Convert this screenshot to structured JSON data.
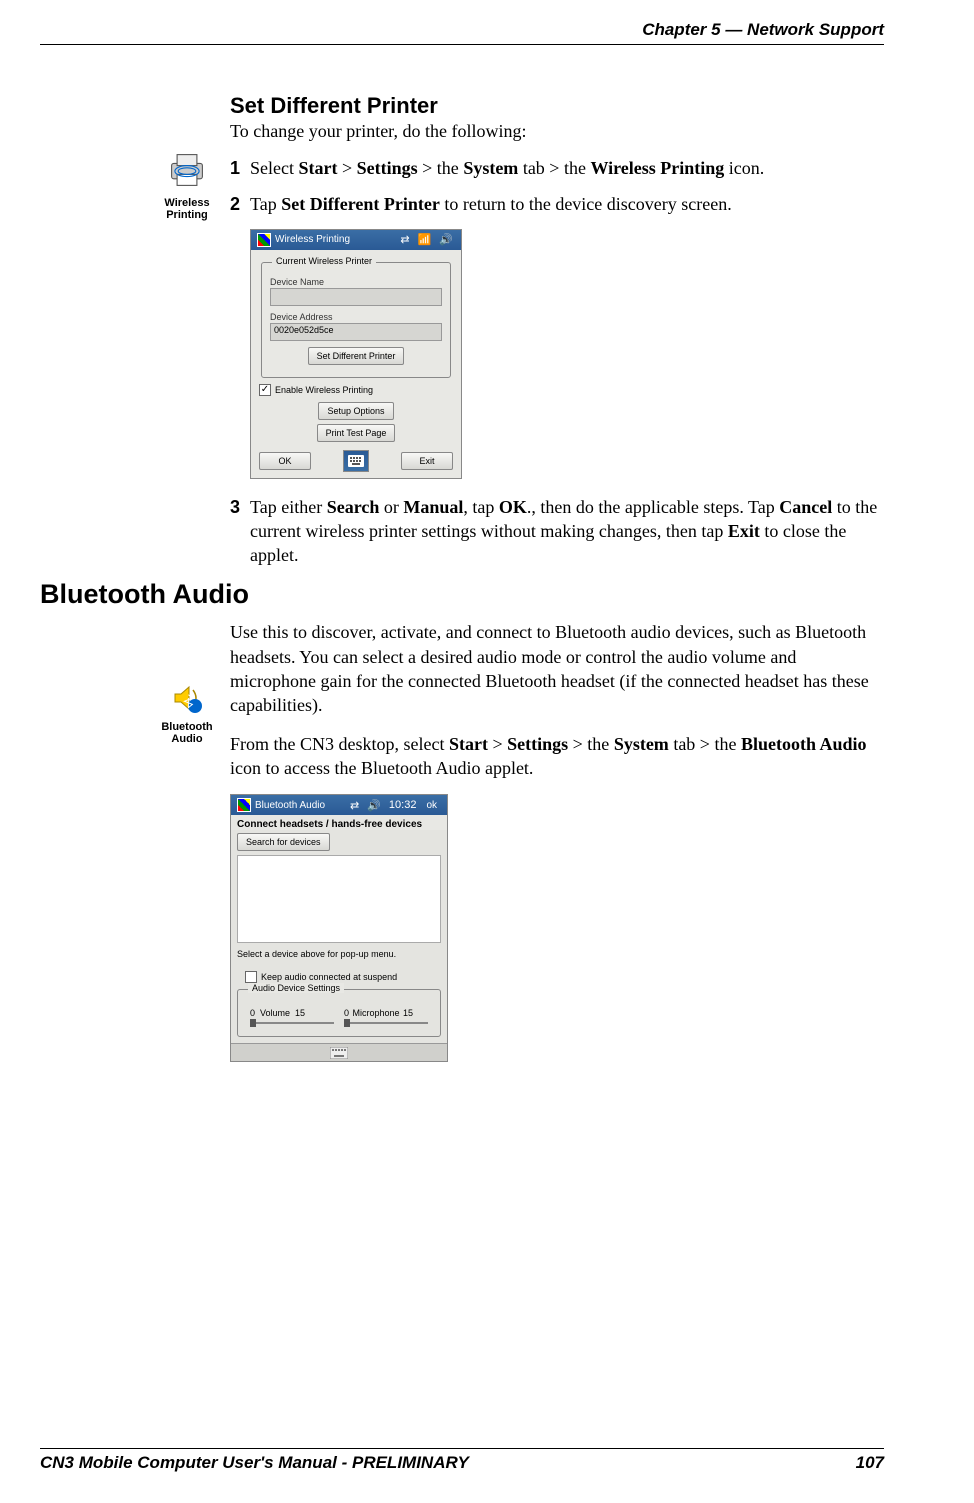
{
  "header": "Chapter 5 —  Network Support",
  "footer": {
    "left": "CN3 Mobile Computer User's Manual - PRELIMINARY",
    "right": "107"
  },
  "section1": {
    "title": "Set Different Printer",
    "intro": "To change your printer, do the following:",
    "icon_label": "Wireless Printing",
    "steps": {
      "s1num": "1",
      "s1a": "Select ",
      "s1b": "Start",
      "s1c": " > ",
      "s1d": "Settings",
      "s1e": " > the ",
      "s1f": "System",
      "s1g": " tab > the ",
      "s1h": "Wireless Printing",
      "s1i": " icon.",
      "s2num": "2",
      "s2a": "Tap ",
      "s2b": "Set Different Printer",
      "s2c": " to return to the device discovery screen.",
      "s3num": "3",
      "s3a": "Tap either ",
      "s3b": "Search",
      "s3c": " or ",
      "s3d": "Manual",
      "s3e": ", tap ",
      "s3f": "OK",
      "s3g": "., then do the applicable steps. Tap ",
      "s3h": "Cancel",
      "s3i": " to the current wireless printer settings without making changes, then tap ",
      "s3j": "Exit",
      "s3k": " to close the applet."
    }
  },
  "shot1": {
    "title": "Wireless Printing",
    "groupbox": "Current Wireless Printer",
    "dev_name_label": "Device Name",
    "dev_name_value": "",
    "dev_addr_label": "Device Address",
    "dev_addr_value": "0020e052d5ce",
    "btn_setdiff": "Set Different Printer",
    "chk_enable": "Enable Wireless Printing",
    "btn_setup": "Setup Options",
    "btn_test": "Print Test Page",
    "btn_ok": "OK",
    "btn_exit": "Exit"
  },
  "section2": {
    "heading": "Bluetooth Audio",
    "icon_label": "Bluetooth Audio",
    "para1": "Use this to discover, activate, and connect to Bluetooth audio devices, such as Bluetooth headsets. You can select a desired audio mode or control the audio volume and microphone gain for the connected Bluetooth headset (if the connected headset has these capabilities).",
    "p2a": "From the CN3 desktop, select ",
    "p2b": "Start",
    "p2c": " > ",
    "p2d": "Settings",
    "p2e": " > the ",
    "p2f": "System",
    "p2g": " tab > the ",
    "p2h": "Bluetooth Audio",
    "p2i": " icon to access the Bluetooth Audio applet."
  },
  "shot2": {
    "title": "Bluetooth Audio",
    "time": "10:32",
    "ok": "ok",
    "subhead": "Connect headsets / hands-free devices",
    "btn_search": "Search for devices",
    "hint": "Select a device above for pop-up menu.",
    "chk_keep": "Keep audio connected at suspend",
    "group": "Audio Device Settings",
    "vol_lo": "0",
    "vol_label": "Volume",
    "vol_hi": "15",
    "mic_lo": "0",
    "mic_label": "Microphone",
    "mic_hi": "15"
  }
}
